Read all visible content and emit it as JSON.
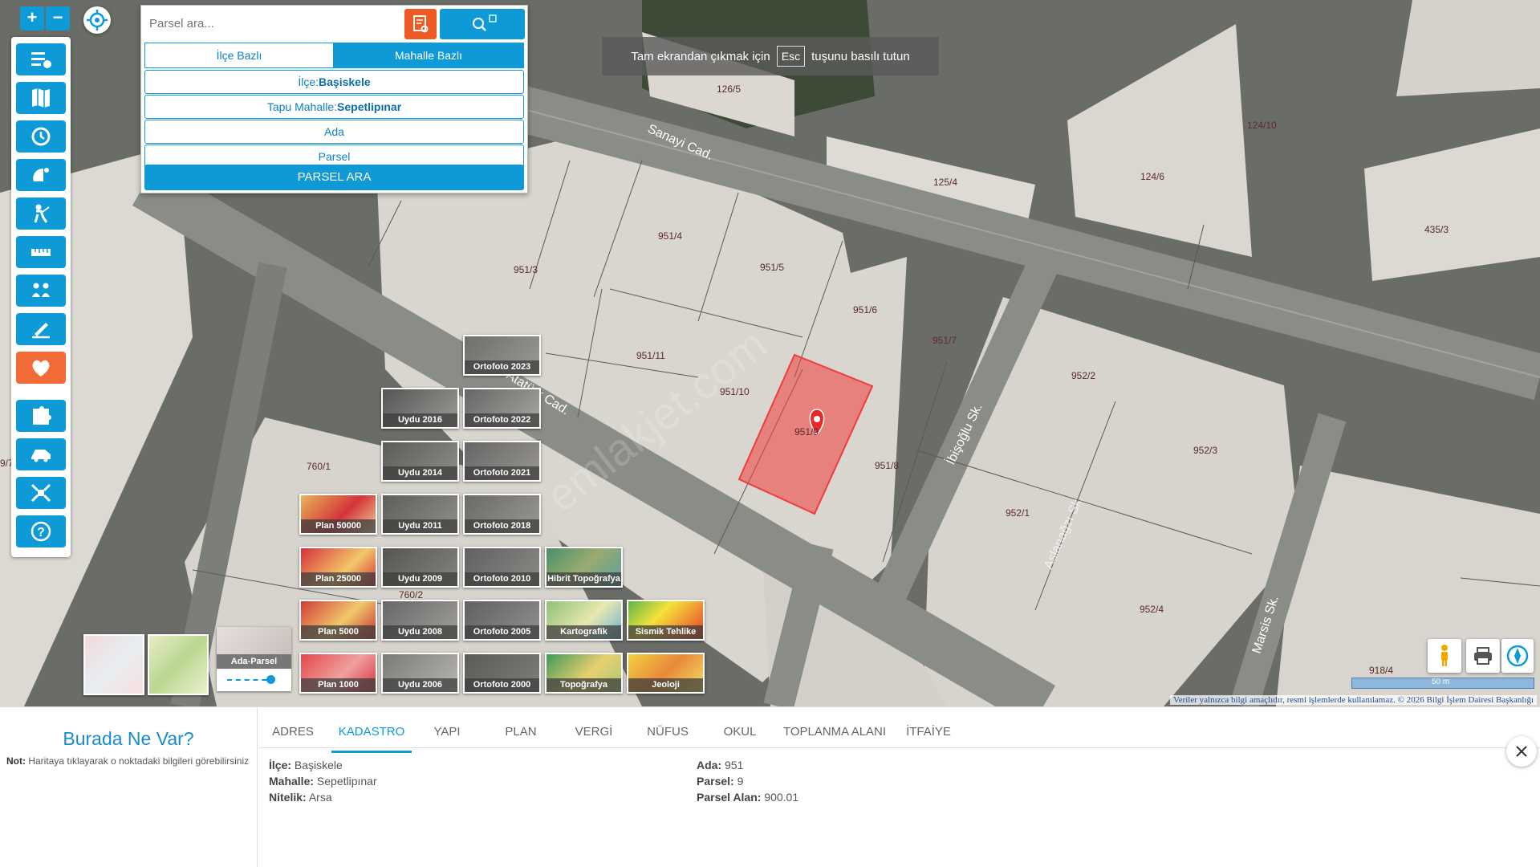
{
  "search": {
    "placeholder": "Parsel ara...",
    "tabs": [
      "İlçe Bazlı",
      "Mahalle Bazlı"
    ],
    "ilce_label": "İlçe:",
    "ilce_value": "Başiskele",
    "mahalle_label": "Tapu Mahalle:",
    "mahalle_value": "Sepetlipınar",
    "ada_label": "Ada",
    "parsel_label": "Parsel",
    "submit_label": "PARSEL ARA"
  },
  "fullscreen_notice": {
    "prefix": "Tam ekrandan çıkmak için",
    "key": "Esc",
    "suffix": "tuşunu basılı tutun"
  },
  "map": {
    "parcels": [
      "126/5",
      "124/10",
      "124/6",
      "435/3",
      "125/4",
      "951/4",
      "951/5",
      "951/3",
      "951/6",
      "951/7",
      "951/11",
      "951/10",
      "951/9",
      "951/8",
      "952/2",
      "952/3",
      "952/1",
      "952/4",
      "760/1",
      "760/2",
      "918/4",
      "9/7"
    ],
    "streets": [
      "Sanayi Cad.",
      "Atatürk Cad.",
      "İbişoğlu Sk.",
      "Aslanağzı Sk.",
      "Marsis Sk."
    ],
    "watermark": "emlakjet.com",
    "scale_label": "50 m",
    "attribution": "Veriler yalnızca bilgi amaçlıdır, resmi işlemlerde kullanılamaz. © 2026 Bilgi İşlem Dairesi Başkanlığı"
  },
  "layers": [
    {
      "label": "Ortofoto 2023"
    },
    {
      "label": "Uydu 2016"
    },
    {
      "label": "Ortofoto 2022"
    },
    {
      "label": "Uydu 2014"
    },
    {
      "label": "Ortofoto 2021"
    },
    {
      "label": "Plan 50000"
    },
    {
      "label": "Uydu 2011"
    },
    {
      "label": "Ortofoto 2018"
    },
    {
      "label": "Plan 25000"
    },
    {
      "label": "Uydu 2009"
    },
    {
      "label": "Ortofoto 2010"
    },
    {
      "label": "Hibrit Topoğrafya"
    },
    {
      "label": "Plan 5000"
    },
    {
      "label": "Uydu 2008"
    },
    {
      "label": "Ortofoto 2005"
    },
    {
      "label": "Kartografik"
    },
    {
      "label": "Sismik Tehlike"
    },
    {
      "label": "Plan 1000"
    },
    {
      "label": "Uydu 2006"
    },
    {
      "label": "Ortofoto 2000"
    },
    {
      "label": "Topoğrafya"
    },
    {
      "label": "Jeoloji"
    }
  ],
  "ada_parsel_label": "Ada-Parsel",
  "info": {
    "title": "Burada Ne Var?",
    "note_label": "Not:",
    "note_text": "Haritaya tıklayarak o noktadaki bilgileri görebilirsiniz"
  },
  "tabs": [
    "ADRES",
    "KADASTRO",
    "YAPI",
    "PLAN",
    "VERGİ",
    "NÜFUS",
    "OKUL",
    "TOPLANMA ALANI",
    "İTFAİYE"
  ],
  "kadastro": {
    "ilce_key": "İlçe:",
    "ilce_val": "Başiskele",
    "mahalle_key": "Mahalle:",
    "mahalle_val": "Sepetlipınar",
    "nitelik_key": "Nitelik:",
    "nitelik_val": "Arsa",
    "ada_key": "Ada:",
    "ada_val": "951",
    "parsel_key": "Parsel:",
    "parsel_val": "9",
    "alan_key": "Parsel Alan:",
    "alan_val": "900.01"
  },
  "colors": {
    "accent": "#0d9ad6",
    "highlight": "#ee5a24",
    "selected_parcel": "#f03c3c"
  }
}
